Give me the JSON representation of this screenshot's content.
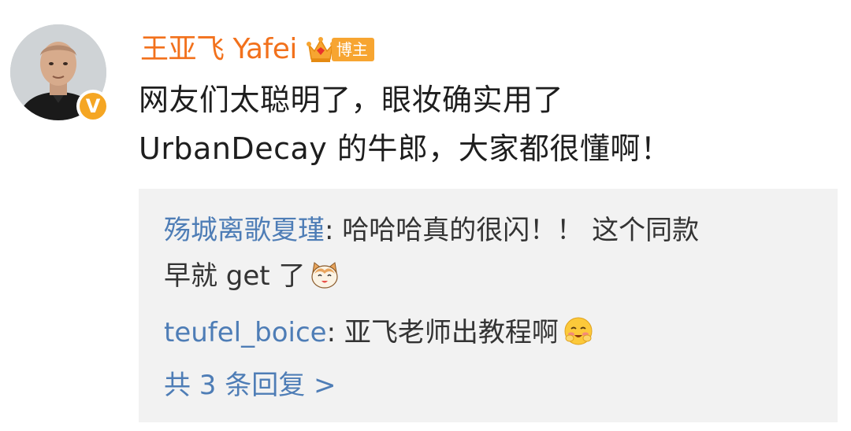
{
  "post": {
    "author": {
      "name": "王亚飞 Yafei",
      "badge_label": "博主",
      "verified_mark": "V",
      "name_color": "#f2711c",
      "badge_color": "#f7a531",
      "verified_color": "#f5a623"
    },
    "text_lines": [
      "网友们太聪明了，眼妆确实用了",
      "UrbanDecay 的牛郎，大家都很懂啊！"
    ]
  },
  "replies": {
    "items": [
      {
        "author": "殇城离歌夏瑾",
        "separator": ": ",
        "text_line1": "哈哈哈真的很闪！！ 这个同款",
        "text_line2": "早就 get 了",
        "emoji_icon": "cat-face-emoji"
      },
      {
        "author": "teufel_boice",
        "separator": ": ",
        "text_line1": "亚飞老师出教程啊",
        "emoji_icon": "blushing-smile-emoji"
      }
    ],
    "more_label": "共 3 条回复 >",
    "link_color": "#4e7db6"
  }
}
